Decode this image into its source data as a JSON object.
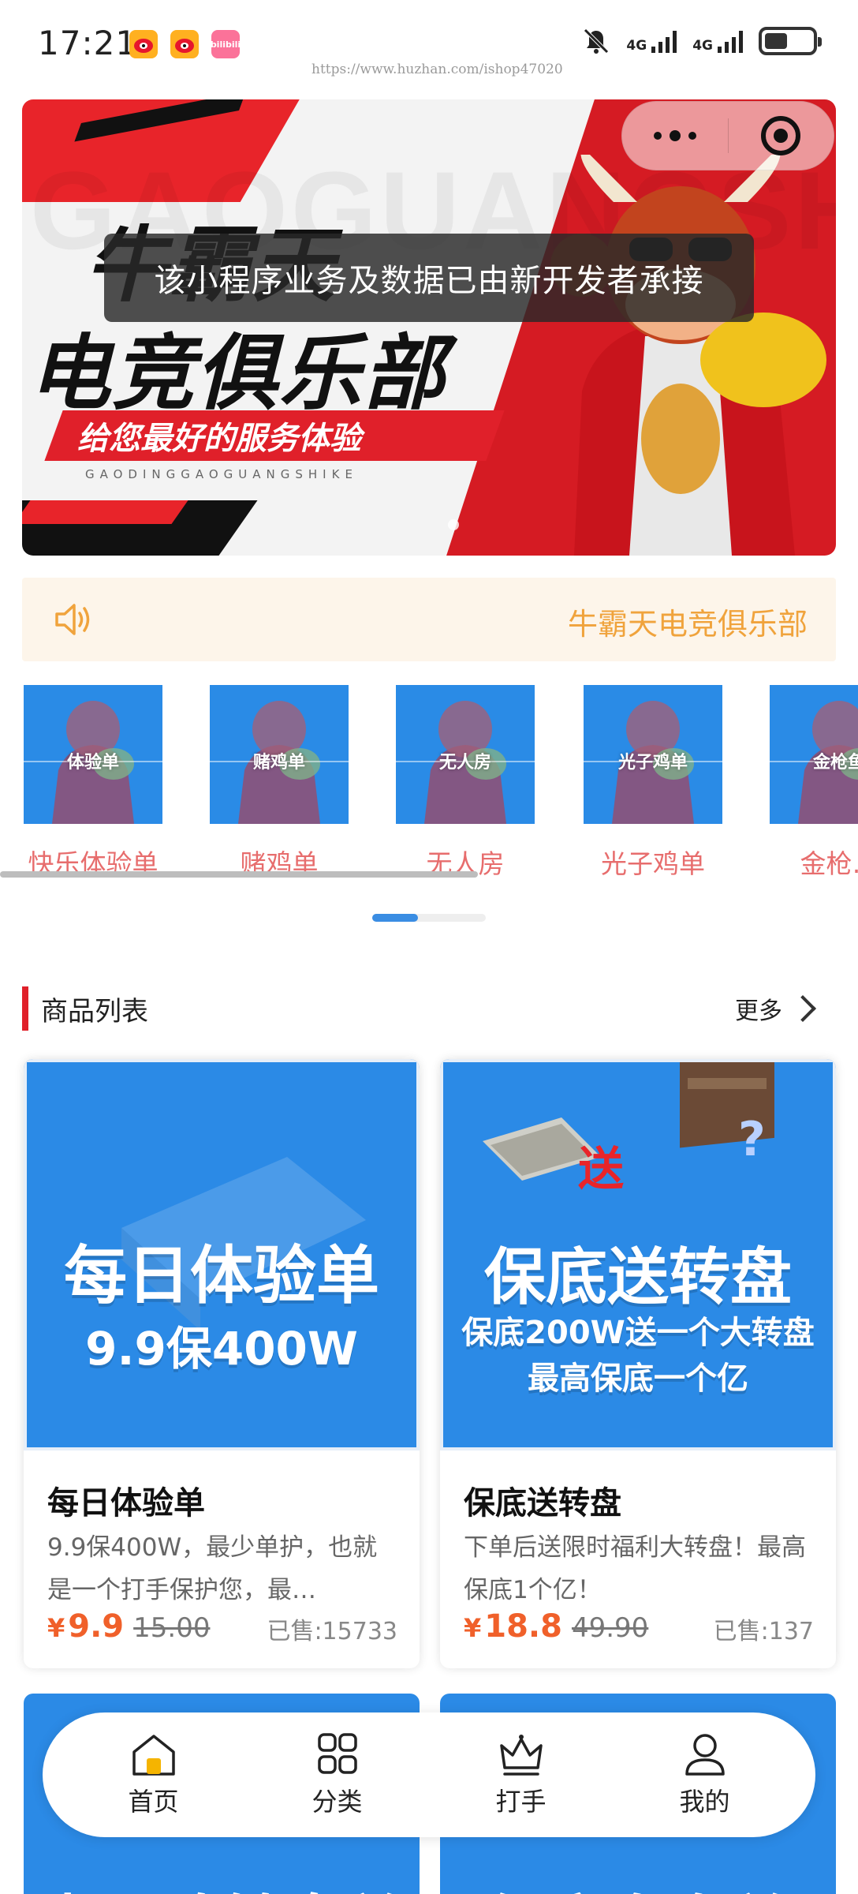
{
  "status_bar": {
    "time": "17:21",
    "network1": "4G",
    "network2": "4G",
    "apps": [
      "weibo-icon",
      "weibo-icon",
      "bilibili-icon"
    ],
    "bilibili_label": "bilibili"
  },
  "watermark": "https://www.huzhan.com/ishop47020",
  "banner": {
    "ghost_text": "GAOGUANGSHI",
    "line1": "牛霸天",
    "line2": "电竞俱乐部",
    "slogan": "给您最好的服务体验",
    "slogan_sub": "GAODINGGAOGUANGSHIKE"
  },
  "toast": "该小程序业务及数据已由新开发者承接",
  "notice": {
    "text": "牛霸天电竞俱乐部"
  },
  "categories": [
    {
      "tag": "体验单",
      "label": "快乐体验单"
    },
    {
      "tag": "赌鸡单",
      "label": "赌鸡单"
    },
    {
      "tag": "无人房",
      "label": "无人房"
    },
    {
      "tag": "光子鸡单",
      "label": "光子鸡单"
    },
    {
      "tag": "金枪鱼",
      "label": "金枪…"
    }
  ],
  "section": {
    "title": "商品列表",
    "more": "更多"
  },
  "products": [
    {
      "img_line1": "每日体验单",
      "img_line2": "9.9保400W",
      "name": "每日体验单",
      "desc": "9.9保400W，最少单护，也就是一个打手保护您，最…",
      "currency": "¥",
      "price": "9.9",
      "old_price": "15.00",
      "sold": "已售:15733"
    },
    {
      "img_line1": "保底送转盘",
      "img_line2": "保底200W送一个大转盘",
      "img_line3": "最高保底一个亿",
      "img_send": "送",
      "name": "保底送转盘",
      "desc": "下单后送限时福利大转盘！最高保底1个亿！",
      "currency": "¥",
      "price": "18.8",
      "old_price": "49.90",
      "sold": "已售:137"
    }
  ],
  "products_partial": [
    {
      "img_line1": "光子鸡转盘单"
    },
    {
      "img_line1": "保底套套单"
    }
  ],
  "tabbar": [
    {
      "label": "首页",
      "icon": "home-icon"
    },
    {
      "label": "分类",
      "icon": "grid-icon"
    },
    {
      "label": "打手",
      "icon": "crown-icon"
    },
    {
      "label": "我的",
      "icon": "user-icon"
    }
  ],
  "colors": {
    "accent_red": "#e0202a",
    "notice_orange": "#f0a33c",
    "price_orange": "#f0602a",
    "category_pink": "#e76d6d",
    "product_blue": "#2b8ae6",
    "home_active": "#f5b400"
  }
}
